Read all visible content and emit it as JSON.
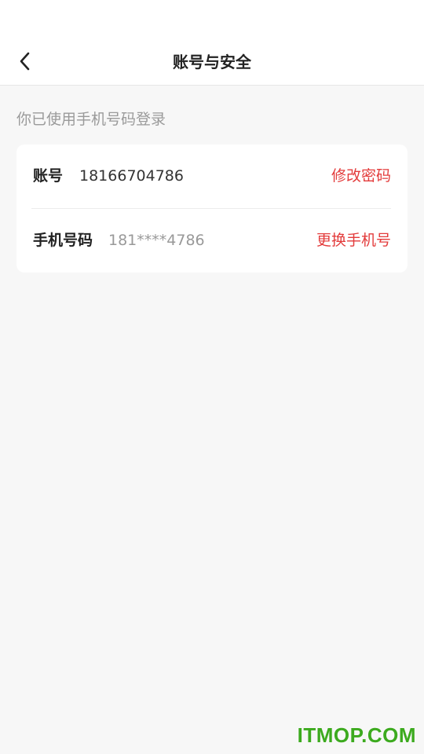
{
  "header": {
    "title": "账号与安全",
    "back_icon": "chevron-left-icon"
  },
  "login_hint": "你已使用手机号码登录",
  "account": {
    "label": "账号",
    "value": "18166704786",
    "action": "修改密码"
  },
  "phone": {
    "label": "手机号码",
    "value": "181****4786",
    "action": "更换手机号"
  },
  "colors": {
    "accent": "#e33b3b",
    "background": "#f7f7f7",
    "card": "#ffffff",
    "watermark": "#3caa1e"
  },
  "watermark": "ITMOP.COM"
}
